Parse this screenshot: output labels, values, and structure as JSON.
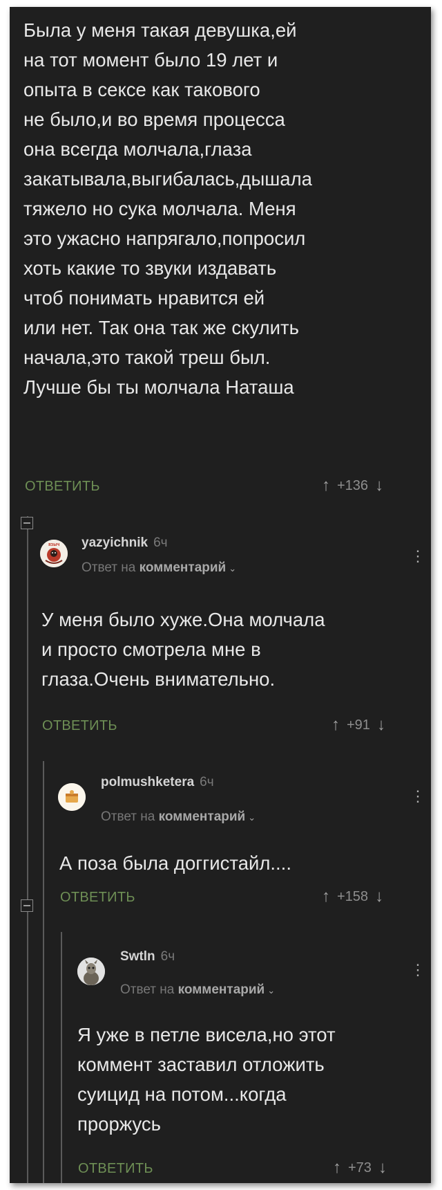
{
  "root": {
    "lines": [
      "Была у меня такая девушка,ей",
      "на тот момент было 19 лет и",
      "опыта в сексе как такового",
      "не было,и во время процесса",
      "она всегда молчала,глаза",
      "закатывала,выгибалась,дышала",
      "тяжело но сука молчала. Меня",
      "это ужасно напрягало,попросил",
      "хоть какие то звуки издавать",
      "чтоб понимать нравится ей",
      "или нет. Так она так же скулить",
      "начала,это такой треш был.",
      "Лучше бы ты молчала Наташа"
    ],
    "reply_label": "ОТВЕТИТЬ",
    "rating": "+136"
  },
  "c1": {
    "user": "yazyichnik",
    "time": "6ч",
    "reply_prefix": "Ответ на",
    "reply_target": "комментарий",
    "lines": [
      "У меня было хуже.Она молчала",
      "и просто смотрела мне в",
      "глаза.Очень внимательно."
    ],
    "reply_label": "ОТВЕТИТЬ",
    "rating": "+91"
  },
  "c2": {
    "user": "polmushketera",
    "time": "6ч",
    "reply_prefix": "Ответ на",
    "reply_target": "комментарий",
    "lines": [
      "А поза была доггистайл...."
    ],
    "reply_label": "ОТВЕТИТЬ",
    "rating": "+158"
  },
  "c3": {
    "user": "Swtln",
    "time": "6ч",
    "reply_prefix": "Ответ на",
    "reply_target": "комментарий",
    "lines": [
      "Я уже в петле висела,но этот",
      "коммент заставил отложить",
      "суицид на потом...когда",
      "проржусь"
    ],
    "reply_label": "ОТВЕТИТЬ",
    "rating": "+73"
  },
  "icons": {
    "upvote": "↑",
    "downvote": "↓",
    "more": "⋮",
    "chevron": "⌄"
  },
  "colors": {
    "background": "#1f1f1f",
    "text": "#e8e8e8",
    "reply": "#6e8f55",
    "muted": "#7a7a7a"
  }
}
